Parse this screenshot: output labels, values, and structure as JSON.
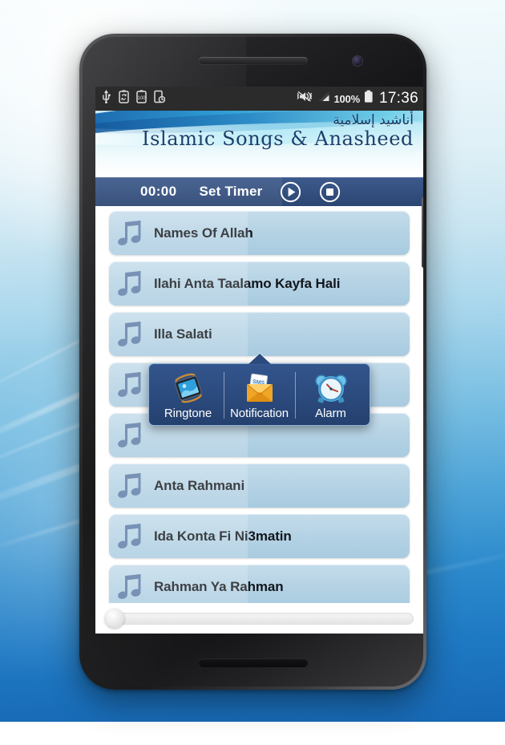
{
  "status_bar": {
    "icons_left": [
      "usb-icon",
      "sync-battery-icon",
      "battery-100-icon",
      "device-clock-icon"
    ],
    "battery_level": "100%",
    "clock": "17:36",
    "icons_right": [
      "vibrate-mute-icon",
      "signal-bars-icon",
      "battery-icon"
    ]
  },
  "banner": {
    "arabic_title": "أناشيد إسلامية",
    "latin_title": "Islamic Songs & Anasheed"
  },
  "timer_bar": {
    "time": "00:00",
    "set_timer_label": "Set Timer",
    "play_icon": "play-icon",
    "stop_icon": "stop-icon",
    "bg_color": "#34507f"
  },
  "song_list": {
    "items": [
      {
        "title": "Names Of Allah",
        "icon": "music-note-icon"
      },
      {
        "title": "Ilahi Anta Taalamo Kayfa Hali",
        "icon": "music-note-icon"
      },
      {
        "title": "Illa Salati",
        "icon": "music-note-icon"
      },
      {
        "title": "",
        "icon": "music-note-icon"
      },
      {
        "title": "",
        "icon": "music-note-icon"
      },
      {
        "title": "Anta Rahmani",
        "icon": "music-note-icon"
      },
      {
        "title": "Ida Konta Fi Ni3matin",
        "icon": "music-note-icon"
      },
      {
        "title": "Rahman Ya Rahman",
        "icon": "music-note-icon"
      }
    ],
    "row_color": "#b4d2e4",
    "icon_color": "#5b7ba6"
  },
  "popup_menu": {
    "items": [
      {
        "label": "Ringtone",
        "icon": "ringing-phone-icon"
      },
      {
        "label": "Notification",
        "icon": "sms-envelope-icon"
      },
      {
        "label": "Alarm",
        "icon": "alarm-clock-icon"
      }
    ],
    "bg_color": "#2b4a7d"
  },
  "seek_bar": {
    "position_percent": 0
  }
}
